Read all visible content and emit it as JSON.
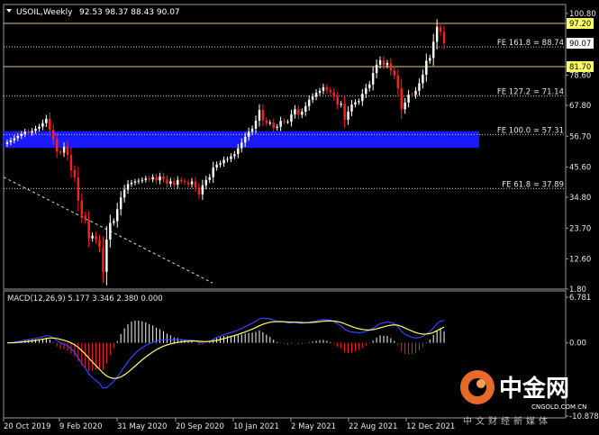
{
  "header": {
    "symbol": "USOIL,Weekly",
    "ohlc": "92.53 98.37 88.43 90.07"
  },
  "price_axis": {
    "ticks": [
      "100.80",
      "89.37",
      "78.60",
      "67.80",
      "56.70",
      "45.60",
      "34.80",
      "23.70",
      "12.60",
      "1.80"
    ],
    "markers": [
      {
        "text": "97.20",
        "value": 97.2,
        "color": "#ffff66"
      },
      {
        "text": "90.07",
        "value": 90.07,
        "color": "#ffffff"
      },
      {
        "text": "81.70",
        "value": 81.7,
        "color": "#ffff66"
      }
    ]
  },
  "fib_levels": [
    {
      "label": "FE 161.8 = 88.74",
      "value": 88.74
    },
    {
      "label": "FE 127.2 = 71.14",
      "value": 71.14
    },
    {
      "label": "FE 100.0 = 57.31",
      "value": 57.31
    },
    {
      "label": "FE 61.8 = 37.89",
      "value": 37.89
    }
  ],
  "horizontal_lines": [
    {
      "value": 97.2,
      "color": "#e8c27a"
    },
    {
      "value": 81.7,
      "color": "#e8c27a"
    }
  ],
  "zone": {
    "from": 52.5,
    "to": 58.5,
    "color": "#1a1aff"
  },
  "trendline": {
    "from": {
      "x_index": 0,
      "value": 42
    },
    "to": {
      "x_index": 118,
      "value": 4
    }
  },
  "macd": {
    "label": "MACD(12,26,9) 5.177 3.346 2.380 0.000",
    "ticks": [
      "6.781",
      "0.00",
      "-10.878"
    ]
  },
  "time_axis": {
    "labels": [
      "20 Oct 2019",
      "9 Feb 2020",
      "31 May 2020",
      "20 Sep 2020",
      "10 Jan 2021",
      "2 May 2021",
      "22 Aug 2021",
      "12 Dec 2021"
    ]
  },
  "watermark": {
    "brand": "中金网",
    "url": "CNGOLD.COM.CN",
    "tagline": "中文财经新媒体"
  },
  "colors": {
    "background": "#000000",
    "bull": "#ffffff",
    "bear": "#ff2020",
    "macd_signal": "#ffff66",
    "macd_line": "#3344ff",
    "zone": "#1a1aff",
    "fib_line": "#cccccc"
  },
  "chart_data": {
    "type": "candlestick",
    "title": "USOIL,Weekly",
    "ylim": [
      1.8,
      104
    ],
    "x_labels": [
      "20 Oct 2019",
      "9 Feb 2020",
      "31 May 2020",
      "20 Sep 2020",
      "10 Jan 2021",
      "2 May 2021",
      "22 Aug 2021",
      "12 Dec 2021"
    ],
    "closes": [
      54.5,
      55.2,
      56.0,
      56.8,
      57.5,
      58.3,
      57.9,
      58.6,
      59.4,
      60.1,
      61.4,
      63.0,
      58.9,
      55.5,
      51.2,
      50.8,
      52.9,
      49.9,
      44.5,
      41.9,
      33.5,
      28.2,
      26.6,
      20.0,
      21.0,
      19.5,
      16.8,
      8.0,
      19.6,
      25.6,
      26.2,
      30.5,
      34.7,
      37.5,
      39.5,
      40.0,
      40.4,
      40.7,
      41.0,
      41.5,
      41.2,
      42.0,
      40.8,
      42.3,
      41.2,
      39.6,
      40.6,
      39.3,
      41.0,
      40.5,
      40.1,
      39.4,
      40.5,
      38.3,
      35.8,
      39.1,
      41.0,
      42.0,
      45.5,
      46.5,
      47.0,
      48.2,
      48.5,
      49.5,
      50.3,
      52.4,
      54.4,
      56.5,
      58.3,
      59.4,
      62.3,
      66.1,
      62.4,
      61.4,
      61.6,
      59.7,
      60.1,
      62.2,
      61.9,
      61.9,
      64.5,
      66.4,
      64.4,
      65.5,
      67.5,
      69.8,
      70.9,
      72.3,
      73.0,
      74.3,
      73.2,
      72.5,
      70.8,
      68.0,
      68.4,
      62.6,
      65.6,
      68.1,
      68.9,
      69.3,
      71.9,
      74.0,
      75.3,
      79.4,
      82.4,
      84.0,
      82.2,
      83.0,
      80.3,
      78.5,
      73.9,
      66.4,
      68.8,
      71.6,
      71.5,
      73.0,
      75.7,
      78.8,
      83.8,
      84.8,
      90.6,
      96.0,
      94.2,
      90.07
    ],
    "macd_line": "approx from -9.5 (Apr 2020) to 5.177",
    "signal_line": "3.346",
    "histogram_last": 2.38,
    "fib_levels": [
      88.74,
      71.14,
      57.31,
      37.89
    ],
    "zone": [
      52.5,
      58.5
    ]
  }
}
